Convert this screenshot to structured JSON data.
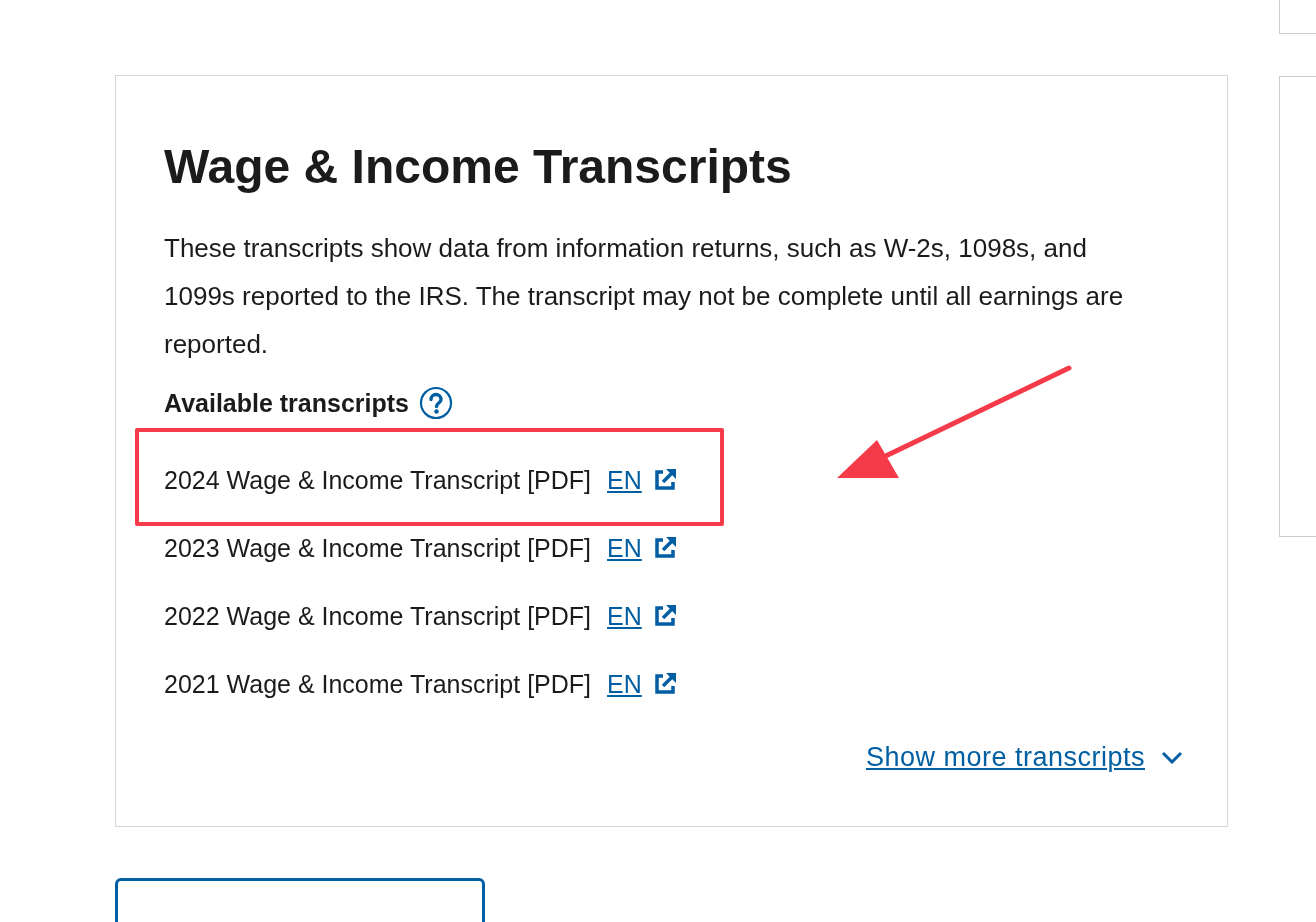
{
  "card": {
    "title": "Wage & Income Transcripts",
    "description": "These transcripts show data from information returns, such as W-2s, 1098s, and 1099s reported to the IRS. The transcript may not be complete until all earnings are reported.",
    "available_label": "Available transcripts",
    "transcripts": [
      {
        "label": "2024 Wage & Income Transcript [PDF]",
        "link": "EN",
        "highlighted": true
      },
      {
        "label": "2023 Wage & Income Transcript [PDF]",
        "link": "EN",
        "highlighted": false
      },
      {
        "label": "2022 Wage & Income Transcript [PDF]",
        "link": "EN",
        "highlighted": false
      },
      {
        "label": "2021 Wage & Income Transcript [PDF]",
        "link": "EN",
        "highlighted": false
      }
    ],
    "show_more": "Show more transcripts"
  }
}
